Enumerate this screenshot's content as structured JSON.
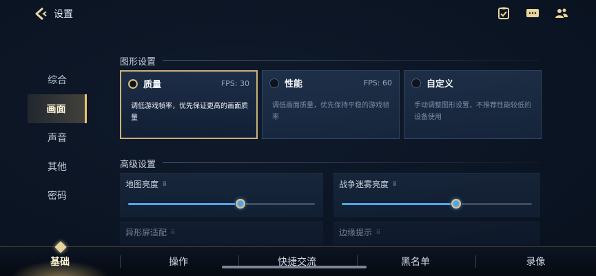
{
  "header": {
    "title": "设置"
  },
  "left_nav": {
    "items": [
      {
        "label": "综合",
        "active": false
      },
      {
        "label": "画面",
        "active": true
      },
      {
        "label": "声音",
        "active": false
      },
      {
        "label": "其他",
        "active": false
      },
      {
        "label": "密码",
        "active": false
      }
    ]
  },
  "graphics": {
    "section_title": "图形设置",
    "options": [
      {
        "name": "质量",
        "fps": "FPS: 30",
        "desc": "调低游戏帧率，优先保证更高的画面质量",
        "selected": true
      },
      {
        "name": "性能",
        "fps": "FPS: 60",
        "desc": "调低画面质量，优先保持平稳的游戏帧率",
        "selected": false
      },
      {
        "name": "自定义",
        "fps": "",
        "desc": "手动调整图形设置，不推荐性能较低的设备使用",
        "selected": false
      }
    ]
  },
  "advanced": {
    "section_title": "高级设置",
    "info_icon": "info-icon",
    "settings": [
      {
        "label": "地图亮度",
        "value": 0.6
      },
      {
        "label": "战争迷雾亮度",
        "value": 0.6
      },
      {
        "label": "异形屏适配"
      },
      {
        "label": "边缘提示"
      }
    ]
  },
  "bottom_tabs": [
    {
      "label": "基础",
      "active": true
    },
    {
      "label": "操作",
      "active": false
    },
    {
      "label": "快捷交流",
      "active": false
    },
    {
      "label": "黑名单",
      "active": false
    },
    {
      "label": "录像",
      "active": false
    }
  ],
  "colors": {
    "accent_gold": "#c9b27a",
    "slider_blue": "#4ea6e8"
  }
}
